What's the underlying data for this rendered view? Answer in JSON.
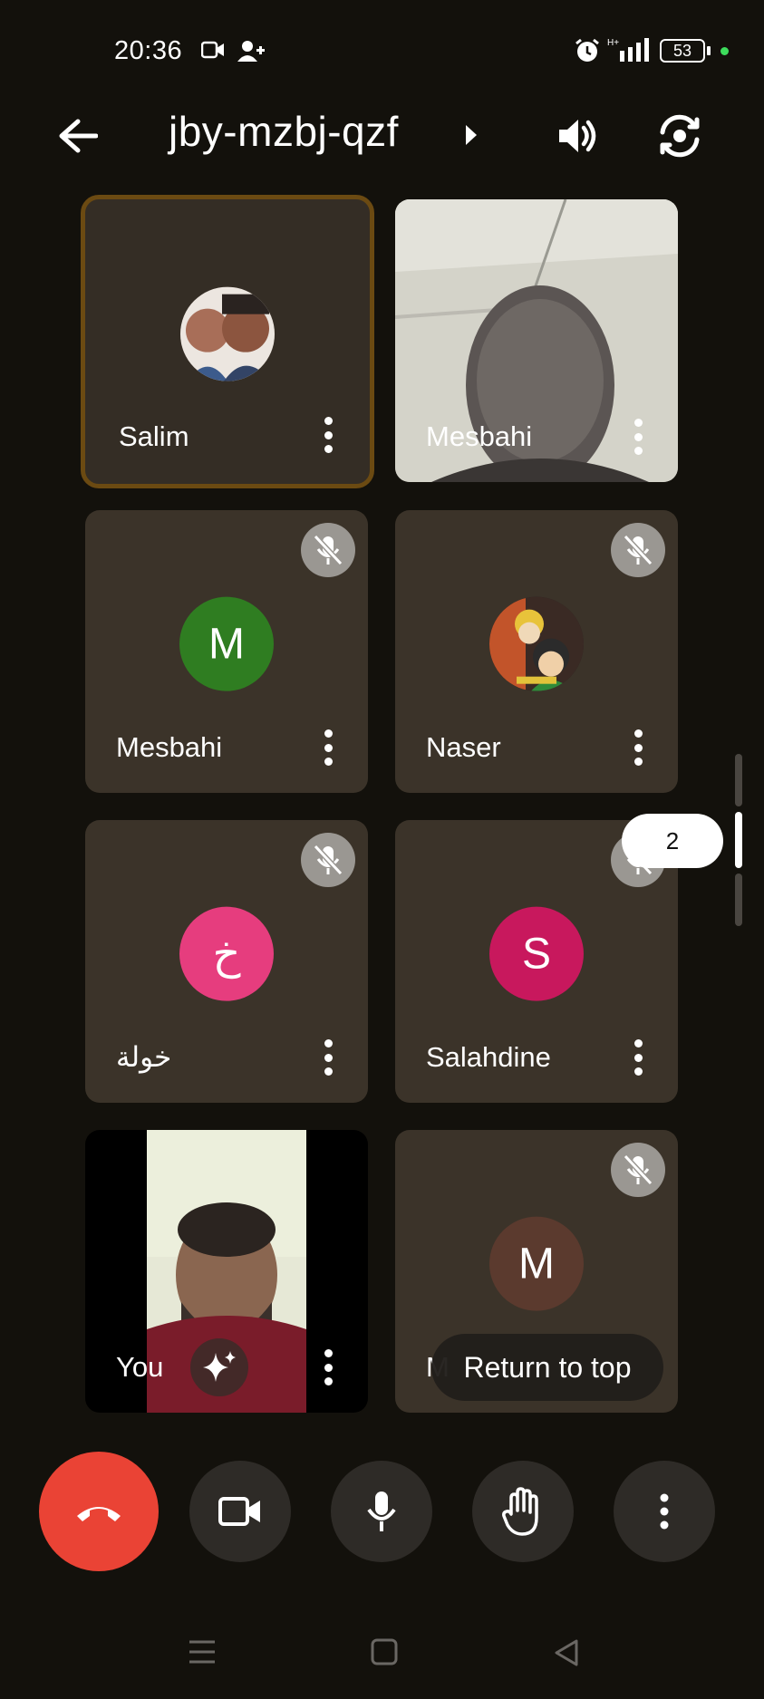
{
  "status_bar": {
    "time": "20:36",
    "battery": "53",
    "icons": [
      "video-camera-icon",
      "add-person-icon",
      "alarm-icon",
      "signal-icon",
      "battery-icon"
    ]
  },
  "header": {
    "meeting_code": "jby-mzbj-qzf",
    "icons": [
      "back-arrow-icon",
      "speaker-icon",
      "switch-camera-icon"
    ]
  },
  "tiles": [
    {
      "name": "Salim",
      "type": "photo-avatar",
      "muted": false,
      "active": true
    },
    {
      "name": "Mesbahi",
      "type": "video",
      "muted": false,
      "active": false
    },
    {
      "name": "Mesbahi",
      "type": "letter-avatar",
      "initial": "M",
      "color": "#2f7d21",
      "muted": true
    },
    {
      "name": "Naser",
      "type": "photo-avatar",
      "muted": true
    },
    {
      "name": "خولة",
      "type": "letter-avatar",
      "initial": "خ",
      "color": "#e63d7e",
      "muted": true
    },
    {
      "name": "Salahdine",
      "type": "letter-avatar",
      "initial": "S",
      "color": "#c8185d",
      "muted": true
    },
    {
      "name": "You",
      "type": "self-video",
      "muted": false
    },
    {
      "name": "Mesbahi",
      "type": "letter-avatar",
      "initial": "M",
      "color": "#5b3a2e",
      "muted": true
    }
  ],
  "last_tile_name_visible": "M",
  "page_indicator": "2",
  "return_to_top": "Return to top",
  "controls": [
    "end-call-button",
    "camera-button",
    "microphone-button",
    "raise-hand-button",
    "more-options-button"
  ],
  "colors": {
    "background": "#13110c",
    "tile": "#3b3329",
    "end_call": "#ea4335",
    "active_border": "#6b4a12"
  }
}
